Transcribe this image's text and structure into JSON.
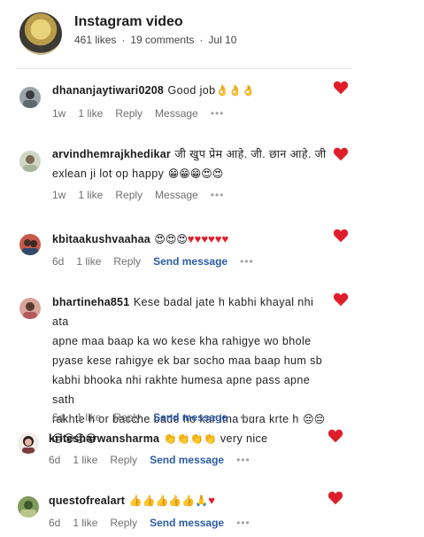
{
  "post": {
    "title": "Instagram video",
    "likes": "461 likes",
    "sep1": "·",
    "comments_count": "19 comments",
    "sep2": "·",
    "date": "Jul 10"
  },
  "actions": {
    "like": "1 like",
    "reply": "Reply",
    "message": "Message",
    "send_message": "Send message",
    "more": "•••"
  },
  "comments": [
    {
      "username": "dhananjaytiwari0208",
      "text": "Good job",
      "emoji": "👌👌👌",
      "age": "1w",
      "action_label": "Message"
    },
    {
      "username": "arvindhemrajkhedikar",
      "text_line1": "जी खुप प्रेम आहे. जी. छान आहे. जी",
      "text_line2": "exlean ji lot op happy",
      "emoji": "😁😁😁😍😍",
      "age": "1w",
      "action_label": "Message"
    },
    {
      "username": "kbitaakushvaahaa",
      "emoji": "😍😍😍",
      "hearts": "♥♥♥♥♥♥",
      "age": "6d",
      "action_label": "Send message"
    },
    {
      "username": "bhartineha851",
      "lines": [
        "Kese badal jate h kabhi khayal nhi ata",
        "apne maa baap ka wo kese kha rahigye wo bhole",
        "pyase kese rahigye ek bar socho maa baap hum sb",
        "kabhi bhooka nhi rakhte humesa apne pass apne sath",
        "rakhte h or bacche bade ho kar itna bura krte h"
      ],
      "emoji_inline": "😔😔",
      "emoji_line": "😔😔😔😔",
      "age": "6d",
      "action_label": "Send message"
    },
    {
      "username": "kritesharwansharma",
      "emoji": "👏👏👏👏",
      "text": "very nice",
      "age": "6d",
      "action_label": "Send message"
    },
    {
      "username": "questofrealart",
      "emoji": "👍👍👍👍👍🙏",
      "heart_char": "♥",
      "age": "6d",
      "action_label": "Send message"
    }
  ],
  "colors": {
    "heart": "#e01e2b",
    "link": "#2b5ca8",
    "muted": "#6f6f6f"
  },
  "icons": {
    "like": "heart-icon",
    "more": "more-dots-icon"
  }
}
